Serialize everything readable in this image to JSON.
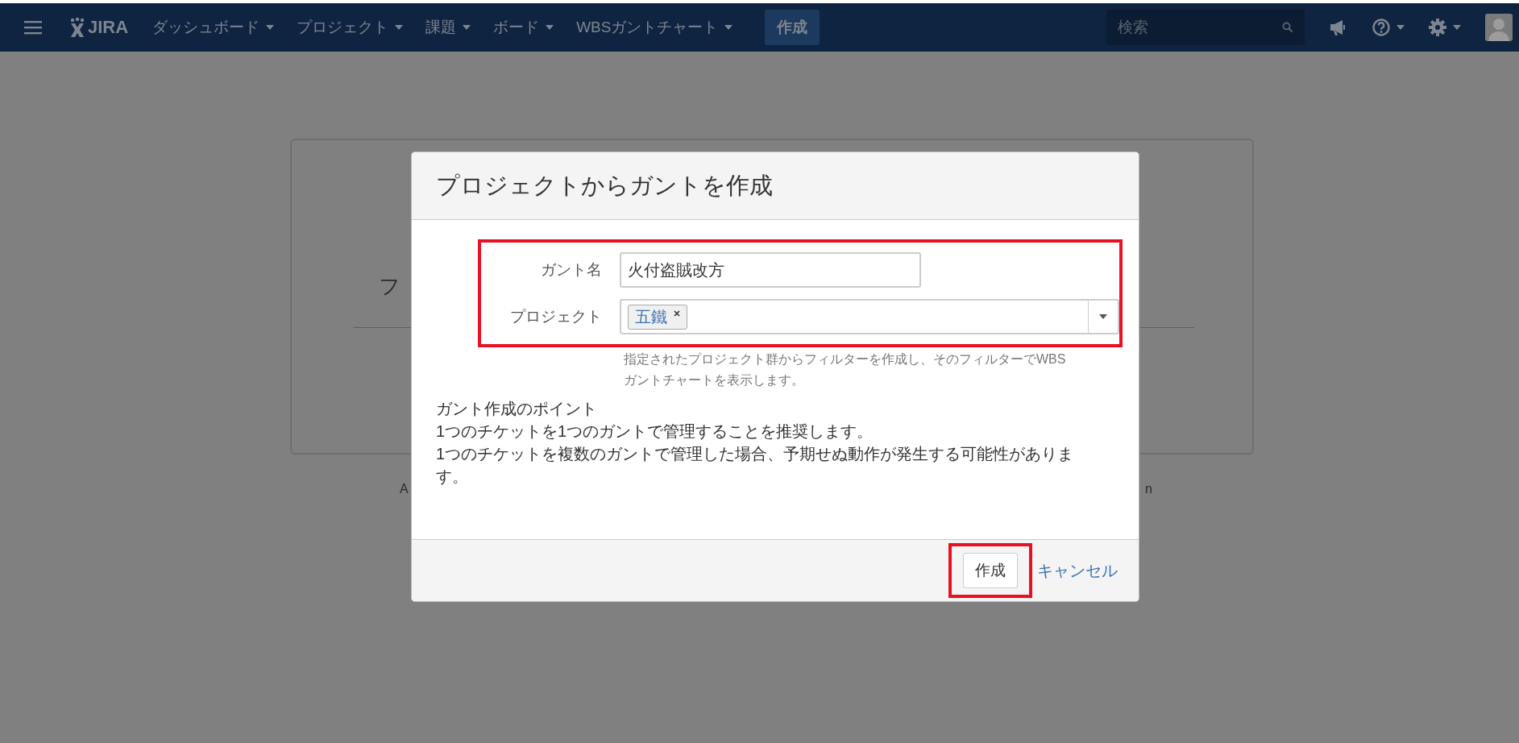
{
  "navbar": {
    "logo": "JIRA",
    "items": [
      {
        "label": "ダッシュボード",
        "has_menu": true
      },
      {
        "label": "プロジェクト",
        "has_menu": true
      },
      {
        "label": "課題",
        "has_menu": true
      },
      {
        "label": "ボード",
        "has_menu": true
      },
      {
        "label": "WBSガントチャート",
        "has_menu": true
      }
    ],
    "create_button": "作成",
    "search": {
      "placeholder": "検索"
    }
  },
  "background": {
    "heading": "フ",
    "footer_left": "A",
    "footer_right": "n"
  },
  "dialog": {
    "title": "プロジェクトからガントを作成",
    "form": {
      "highlighted": true,
      "fields": [
        {
          "kind": "text",
          "label": "ガント名",
          "value": "火付盗賊改方"
        },
        {
          "kind": "multiselect",
          "label": "プロジェクト",
          "tags": [
            "五鐵"
          ]
        }
      ]
    },
    "help": "指定されたプロジェクト群からフィルターを作成し、そのフィルターでWBSガントチャートを表示します。",
    "notes": [
      "ガント作成のポイント",
      "1つのチケットを1つのガントで管理することを推奨します。",
      "1つのチケットを複数のガントで管理した場合、予期せぬ動作が発生する可能性があります。"
    ],
    "submit": {
      "label": "作成",
      "highlighted": true
    },
    "cancel": "キャンセル"
  }
}
